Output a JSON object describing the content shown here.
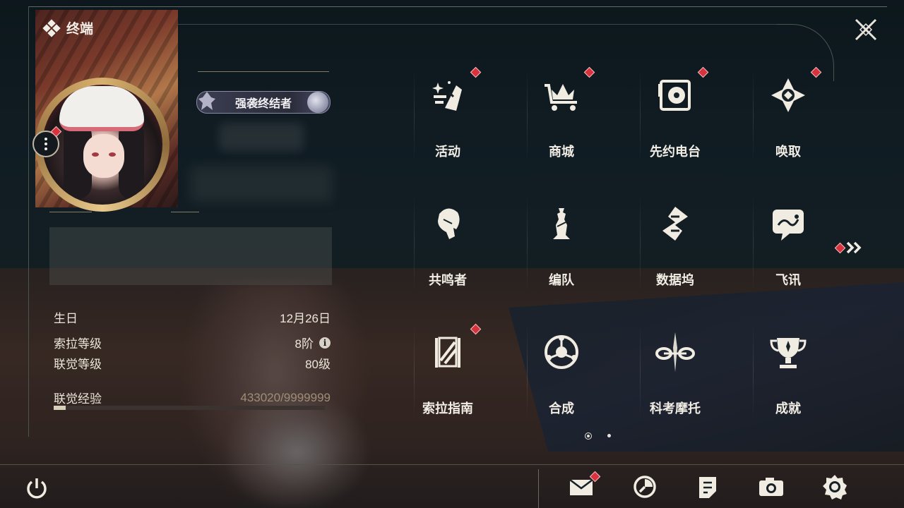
{
  "header": {
    "title": "终端"
  },
  "profile": {
    "title_badge": "强袭终结者",
    "stats": [
      {
        "label": "生日",
        "value": "12月26日"
      },
      {
        "label": "索拉等级",
        "value": "8阶",
        "info": "i"
      },
      {
        "label": "联觉等级",
        "value": "80级"
      }
    ],
    "exp": {
      "label": "联觉经验",
      "value": "433020/9999999",
      "fraction": 0.043
    }
  },
  "menu": [
    {
      "label": "活动",
      "icon": "event-icon",
      "badge": true
    },
    {
      "label": "商城",
      "icon": "shop-crown-cart-icon",
      "badge": true
    },
    {
      "label": "先约电台",
      "icon": "radio-turntable-icon",
      "badge": true
    },
    {
      "label": "唤取",
      "icon": "summon-compass-icon",
      "badge": true
    },
    {
      "label": "共鸣者",
      "icon": "resonator-portrait-icon",
      "badge": false
    },
    {
      "label": "编队",
      "icon": "team-chess-icon",
      "badge": false
    },
    {
      "label": "数据坞",
      "icon": "data-dock-icon",
      "badge": false
    },
    {
      "label": "飞讯",
      "icon": "message-chat-icon",
      "badge": false
    },
    {
      "label": "索拉指南",
      "icon": "guide-book-icon",
      "badge": true
    },
    {
      "label": "合成",
      "icon": "synthesis-icon",
      "badge": false
    },
    {
      "label": "科考摩托",
      "icon": "motorbike-icon",
      "badge": false
    },
    {
      "label": "成就",
      "icon": "trophy-icon",
      "badge": false
    }
  ],
  "pagination": {
    "current": 1,
    "total": 2
  },
  "bottom_bar": [
    "mail-icon",
    "clock-icon",
    "notes-icon",
    "camera-icon",
    "settings-gear-icon"
  ],
  "colors": {
    "badge_red": "#d8323f",
    "accent_gold": "#d7b06d",
    "text": "#f1ede4"
  }
}
